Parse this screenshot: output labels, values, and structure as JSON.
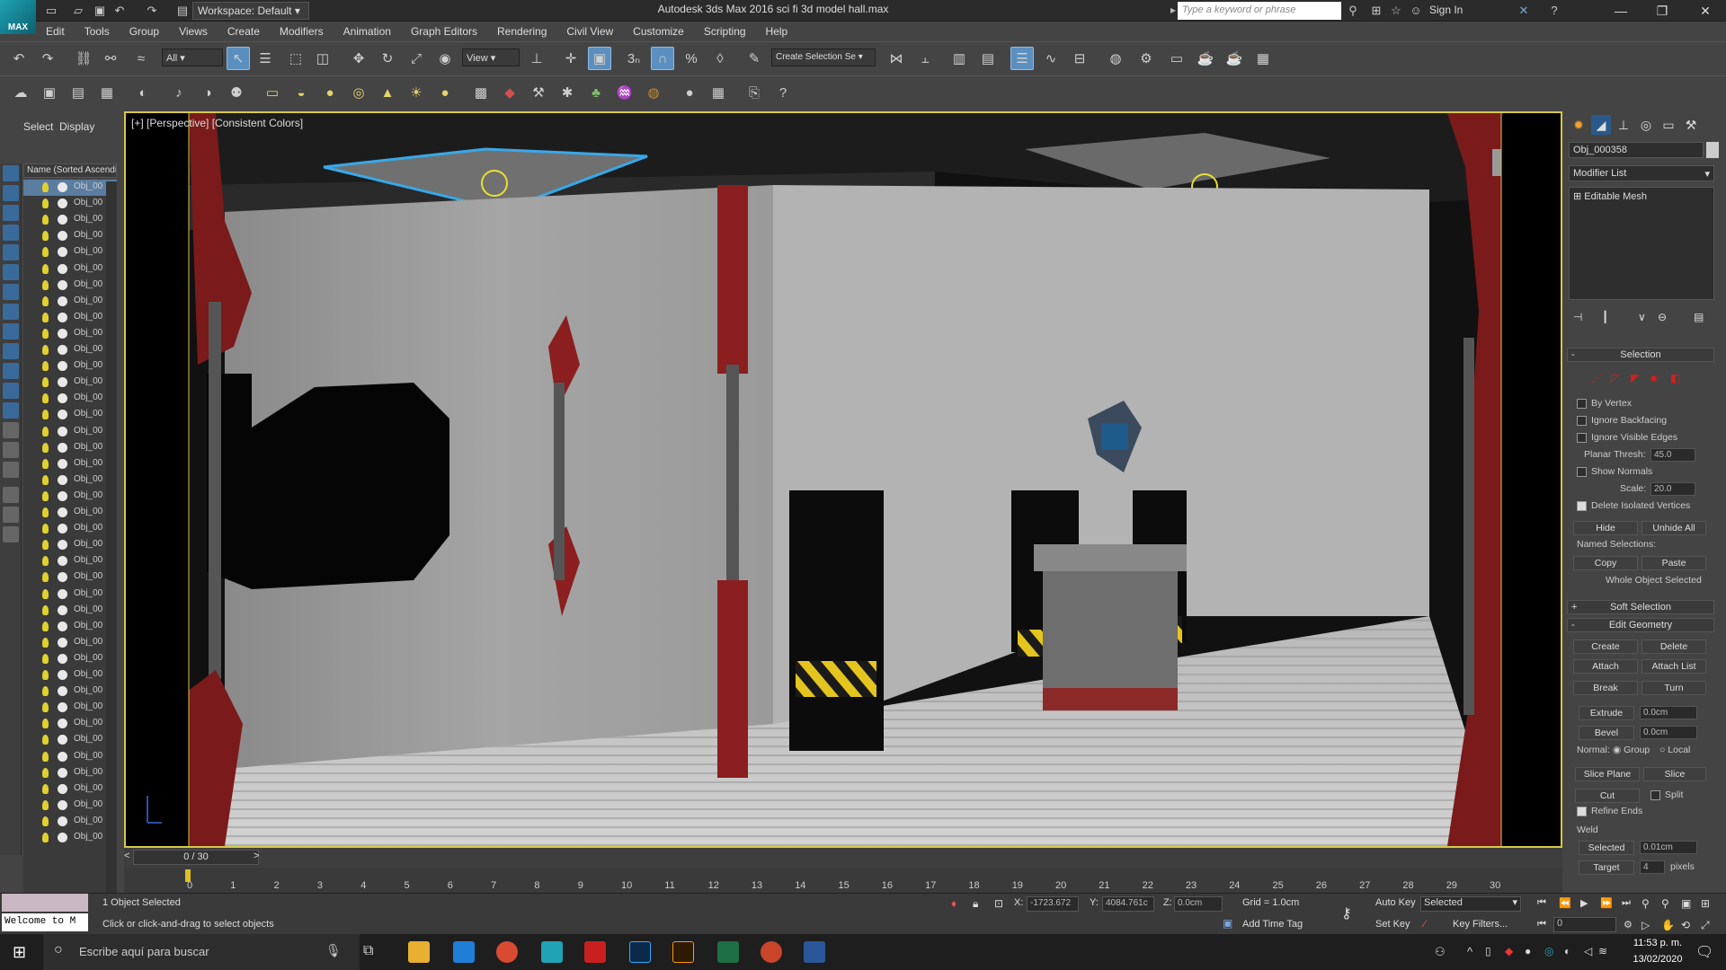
{
  "titlebar": {
    "logo_text": "MAX",
    "workspace": "Workspace: Default",
    "title": "Autodesk 3ds Max 2016    sci fi 3d model hall.max",
    "search_placeholder": "Type a keyword or phrase",
    "signin": "Sign In"
  },
  "menu": [
    "Edit",
    "Tools",
    "Group",
    "Views",
    "Create",
    "Modifiers",
    "Animation",
    "Graph Editors",
    "Rendering",
    "Civil View",
    "Customize",
    "Scripting",
    "Help"
  ],
  "toolbar": {
    "selection_filter": "All",
    "ref_coord": "View",
    "named_selection": "Create Selection Se"
  },
  "scene_explorer": {
    "tabs": [
      "Select",
      "Display"
    ],
    "column_header": "Name (Sorted Ascending)",
    "item_label": "Obj_00"
  },
  "viewport": {
    "label": "[+] [Perspective] [Consistent Colors]"
  },
  "command_panel": {
    "object_name": "Obj_000358",
    "modifier_list": "Modifier List",
    "stack_item": "Editable Mesh",
    "selection": {
      "title": "Selection",
      "by_vertex": "By Vertex",
      "ignore_backfacing": "Ignore Backfacing",
      "ignore_visible_edges": "Ignore Visible Edges",
      "planar_thresh_label": "Planar Thresh:",
      "planar_thresh": "45.0",
      "show_normals": "Show Normals",
      "scale_label": "Scale:",
      "scale": "20.0",
      "delete_isolated": "Delete Isolated Vertices",
      "hide": "Hide",
      "unhide_all": "Unhide All",
      "named_selections": "Named Selections:",
      "copy": "Copy",
      "paste": "Paste",
      "whole_object": "Whole Object Selected"
    },
    "soft_selection": "Soft Selection",
    "edit_geometry": {
      "title": "Edit Geometry",
      "create": "Create",
      "delete": "Delete",
      "attach": "Attach",
      "attach_list": "Attach List",
      "break": "Break",
      "turn": "Turn",
      "extrude": "Extrude",
      "extrude_val": "0.0cm",
      "bevel": "Bevel",
      "bevel_val": "0.0cm",
      "normal_label": "Normal:",
      "group": "Group",
      "local": "Local",
      "slice_plane": "Slice Plane",
      "slice": "Slice",
      "cut": "Cut",
      "split": "Split",
      "refine_ends": "Refine Ends",
      "weld": "Weld",
      "selected": "Selected",
      "selected_val": "0.01cm",
      "target": "Target",
      "target_val": "4",
      "pixels": "pixels"
    }
  },
  "timeline": {
    "frame_slider": "0 / 30",
    "ticks": [
      "0",
      "1",
      "2",
      "3",
      "4",
      "5",
      "6",
      "7",
      "8",
      "9",
      "10",
      "11",
      "12",
      "13",
      "14",
      "15",
      "16",
      "17",
      "18",
      "19",
      "20",
      "21",
      "22",
      "23",
      "24",
      "25",
      "26",
      "27",
      "28",
      "29",
      "30"
    ]
  },
  "status": {
    "listener": "Welcome to M",
    "objects_selected": "1 Object Selected",
    "prompt": "Click or click-and-drag to select objects",
    "x_label": "X:",
    "x": "-1723.672",
    "y_label": "Y:",
    "y": "4084.761c",
    "z_label": "Z:",
    "z": "0.0cm",
    "grid": "Grid = 1.0cm",
    "add_time_tag": "Add Time Tag",
    "auto_key": "Auto Key",
    "selected_dropdown": "Selected",
    "set_key": "Set Key",
    "key_filters": "Key Filters...",
    "current_frame": "0"
  },
  "taskbar": {
    "search": "Escribe aquí para buscar",
    "time": "11:53 p. m.",
    "date": "13/02/2020"
  }
}
